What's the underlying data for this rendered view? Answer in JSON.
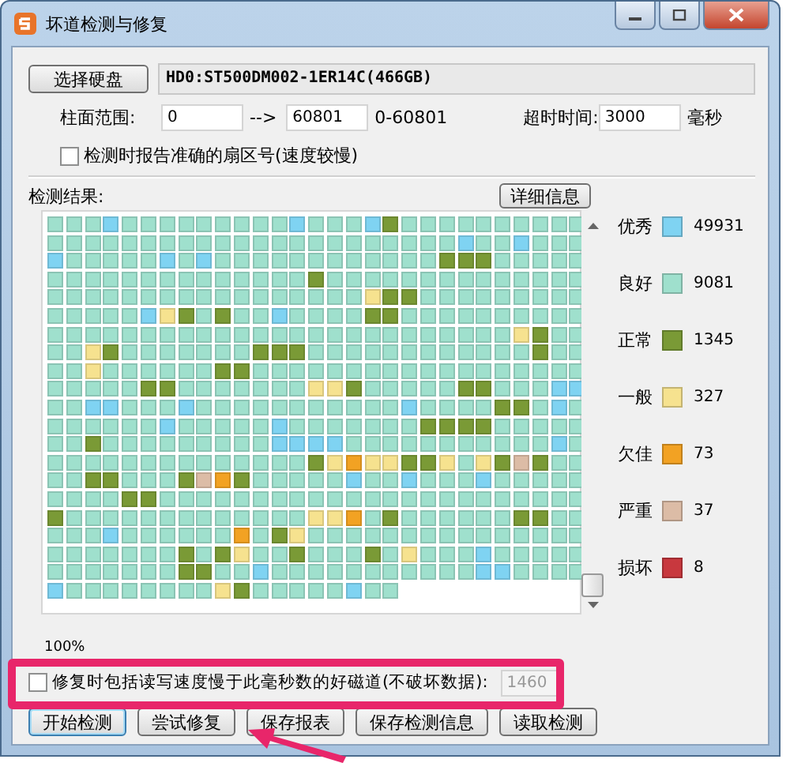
{
  "window": {
    "title": "坏道检测与修复"
  },
  "disk": {
    "button": "选择硬盘",
    "value": "HD0:ST500DM002-1ER14C(466GB)"
  },
  "range": {
    "label": "柱面范围:",
    "from": "0",
    "arrow": "-->",
    "to": "60801",
    "hint": "0-60801"
  },
  "timeout": {
    "label": "超时时间:",
    "value": "3000",
    "unit": "毫秒"
  },
  "report_sector": {
    "label": "检测时报告准确的扇区号(速度较慢)",
    "checked": false
  },
  "results": {
    "label": "检测结果:",
    "details_button": "详细信息",
    "legend": [
      {
        "label": "优秀",
        "color": "#7fd3f2",
        "count": "49931"
      },
      {
        "label": "良好",
        "color": "#9fe0cd",
        "count": "9081"
      },
      {
        "label": "正常",
        "color": "#7a9a36",
        "count": "1345"
      },
      {
        "label": "一般",
        "color": "#f6e28f",
        "count": "327"
      },
      {
        "label": "欠佳",
        "color": "#f2a223",
        "count": "73"
      },
      {
        "label": "严重",
        "color": "#dcbca6",
        "count": "37"
      },
      {
        "label": "损坏",
        "color": "#c8383e",
        "count": "8"
      }
    ],
    "progress": "100%"
  },
  "repair_slow": {
    "label": "修复时包括读写速度慢于此毫秒数的好磁道(不破坏数据):",
    "checked": false,
    "value": "1460",
    "disabled": true
  },
  "buttons": [
    "开始检测",
    "尝试修复",
    "保存报表",
    "保存检测信息",
    "读取检测"
  ]
}
